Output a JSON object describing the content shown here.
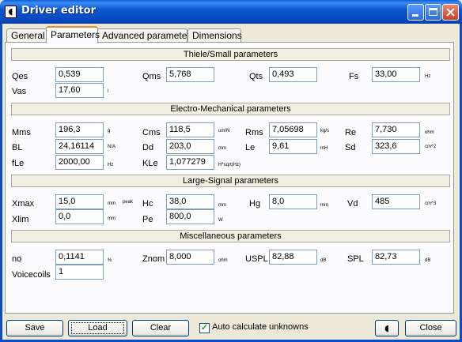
{
  "window": {
    "title": "Driver editor",
    "icon": "speaker-icon"
  },
  "tabs": [
    {
      "label": "General",
      "active": false
    },
    {
      "label": "Parameters",
      "active": true
    },
    {
      "label": "Advanced parameters",
      "active": false
    },
    {
      "label": "Dimensions",
      "active": false
    }
  ],
  "sections": {
    "thiele_small": "Thiele/Small parameters",
    "electro_mechanical": "Electro-Mechanical parameters",
    "large_signal": "Large-Signal parameters",
    "misc": "Miscellaneous parameters"
  },
  "params": {
    "qes": {
      "label": "Qes",
      "value": "0,539",
      "unit": ""
    },
    "qms": {
      "label": "Qms",
      "value": "5,768",
      "unit": ""
    },
    "qts": {
      "label": "Qts",
      "value": "0,493",
      "unit": ""
    },
    "fs": {
      "label": "Fs",
      "value": "33,00",
      "unit": "Hz"
    },
    "vas": {
      "label": "Vas",
      "value": "17,60",
      "unit": "l"
    },
    "mms": {
      "label": "Mms",
      "value": "196,3",
      "unit": "g"
    },
    "cms": {
      "label": "Cms",
      "value": "118,5",
      "unit": "um/N"
    },
    "rms": {
      "label": "Rms",
      "value": "7,05698",
      "unit": "kg/s"
    },
    "re": {
      "label": "Re",
      "value": "7,730",
      "unit": "ohm"
    },
    "bl": {
      "label": "BL",
      "value": "24,16114",
      "unit": "N/A"
    },
    "dd": {
      "label": "Dd",
      "value": "203,0",
      "unit": "mm"
    },
    "le": {
      "label": "Le",
      "value": "9,61",
      "unit": "mH"
    },
    "sd": {
      "label": "Sd",
      "value": "323,6",
      "unit": "cm^2"
    },
    "fle": {
      "label": "fLe",
      "value": "2000,00",
      "unit": "Hz"
    },
    "kle": {
      "label": "KLe",
      "value": "1,077279",
      "unit": "H*sqrt(Hz)"
    },
    "xmax": {
      "label": "Xmax",
      "value": "15,0",
      "unit": "mm",
      "unit2": "peak"
    },
    "hc": {
      "label": "Hc",
      "value": "38,0",
      "unit": "mm"
    },
    "hg": {
      "label": "Hg",
      "value": "8,0",
      "unit": "mm"
    },
    "vd": {
      "label": "Vd",
      "value": "485",
      "unit": "cm^3"
    },
    "xlim": {
      "label": "Xlim",
      "value": "0,0",
      "unit": "mm"
    },
    "pe": {
      "label": "Pe",
      "value": "800,0",
      "unit": "W"
    },
    "no": {
      "label": "no",
      "value": "0,1141",
      "unit": "%"
    },
    "znom": {
      "label": "Znom",
      "value": "8,000",
      "unit": "ohm"
    },
    "uspl": {
      "label": "USPL",
      "value": "82,88",
      "unit": "dB"
    },
    "spl": {
      "label": "SPL",
      "value": "82,73",
      "unit": "dB"
    },
    "voicecoils": {
      "label": "Voicecoils",
      "value": "1",
      "unit": ""
    }
  },
  "footer": {
    "save": "Save",
    "load": "Load",
    "clear": "Clear",
    "auto_calc": "Auto calculate unknowns",
    "auto_calc_checked": true,
    "close": "Close",
    "speaker_button_icon": "speaker-icon"
  }
}
